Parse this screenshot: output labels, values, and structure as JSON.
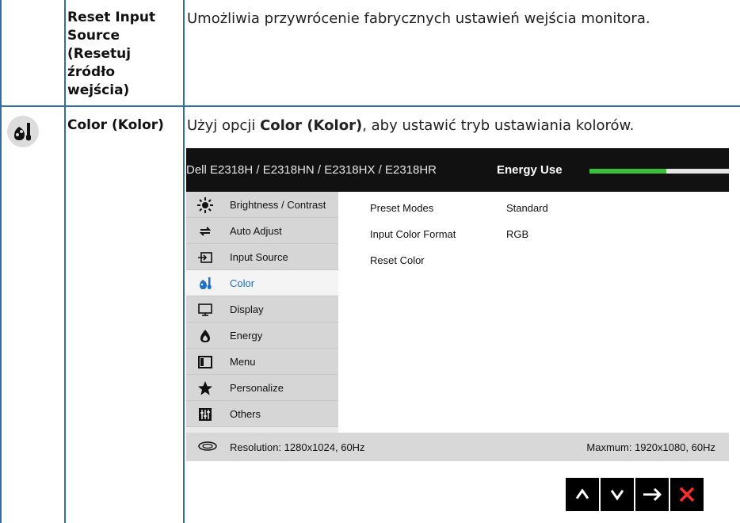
{
  "rows": [
    {
      "name": "Reset Input\nSource\n(Resetuj\nźródło\nwejścia)",
      "description": "Umożliwia przywrócenie fabrycznych ustawień wejścia monitora."
    },
    {
      "name": "Color (Kolor)",
      "description_before": "Użyj opcji ",
      "description_bold": "Color (Kolor)",
      "description_after": ", aby ustawić tryb ustawiania kolorów."
    }
  ],
  "osd": {
    "title": "Dell E2318H / E2318HN / E2318HX / E2318HR",
    "energy_label": "Energy Use",
    "energy_level": 0.55,
    "menu": [
      {
        "label": "Brightness / Contrast",
        "icon": "brightness-icon"
      },
      {
        "label": "Auto Adjust",
        "icon": "auto-adjust-icon"
      },
      {
        "label": "Input Source",
        "icon": "input-source-icon"
      },
      {
        "label": "Color",
        "icon": "color-icon",
        "active": true
      },
      {
        "label": "Display",
        "icon": "display-icon"
      },
      {
        "label": "Energy",
        "icon": "energy-icon"
      },
      {
        "label": "Menu",
        "icon": "menu-icon"
      },
      {
        "label": "Personalize",
        "icon": "star-icon"
      },
      {
        "label": "Others",
        "icon": "others-icon"
      }
    ],
    "panel": [
      {
        "label": "Preset Modes",
        "value": "Standard"
      },
      {
        "label": "Input Color Format",
        "value": "RGB"
      },
      {
        "label": "Reset Color",
        "value": ""
      }
    ],
    "footer": {
      "resolution": "Resolution: 1280x1024, 60Hz",
      "maximum": "Maxmum: 1920x1080, 60Hz"
    }
  },
  "nav_buttons": [
    {
      "icon": "up-icon",
      "glyph": "⌃"
    },
    {
      "icon": "down-icon",
      "glyph": "⌄"
    },
    {
      "icon": "right-arrow-icon",
      "glyph": "→"
    },
    {
      "icon": "close-icon",
      "glyph": "✕"
    }
  ],
  "colors": {
    "grid": "#2f6fa3",
    "energy_fill": "#3cbf3a",
    "active_menu_text": "#1c6fd1",
    "close": "#ff2a2a"
  }
}
